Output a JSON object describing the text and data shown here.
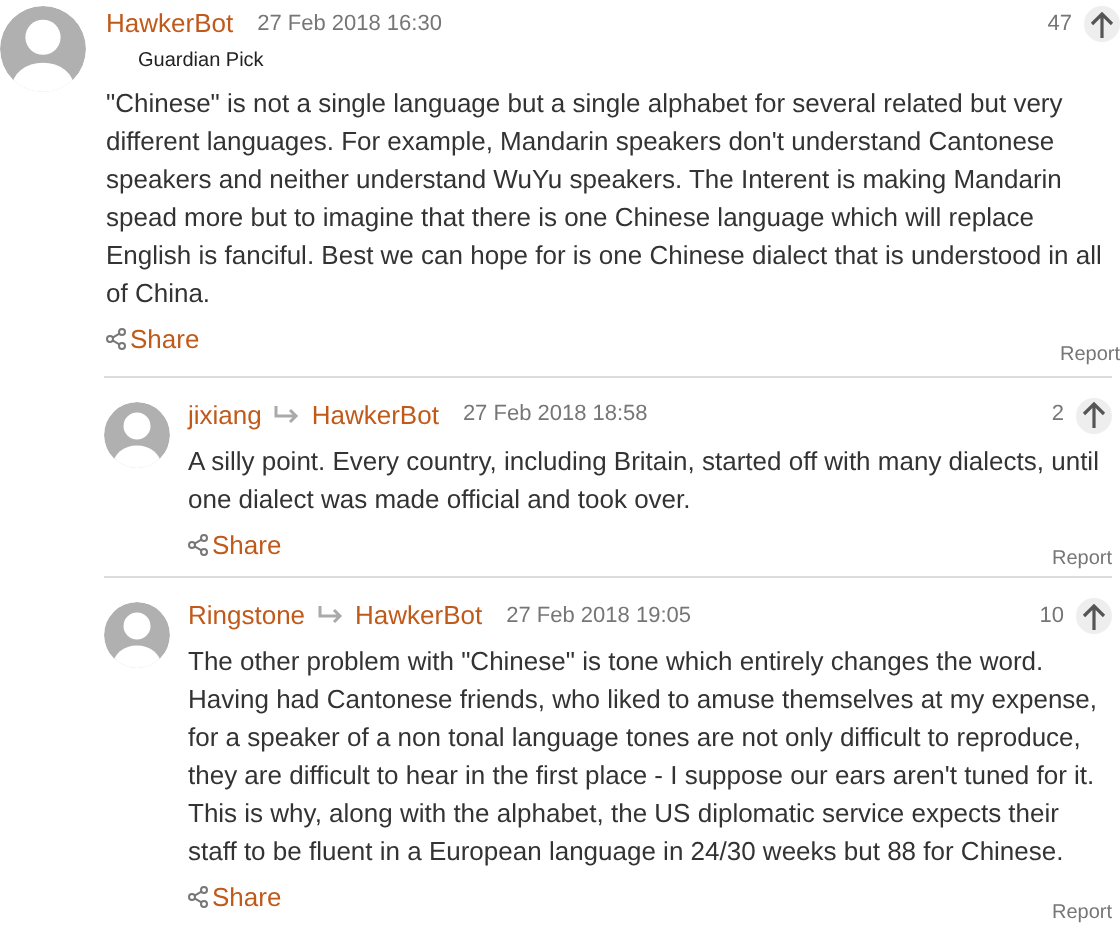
{
  "comments": [
    {
      "author": "HawkerBot",
      "timestamp": "27 Feb 2018 16:30",
      "badge": "Guardian Pick",
      "recommends": "47",
      "body": "\"Chinese\" is not a single language but a single alphabet for several related but very different languages. For example, Mandarin speakers don't understand Cantonese speakers and neither understand WuYu speakers. The Interent is making Mandarin spead more but to imagine that there is one Chinese language which will replace English is fanciful. Best we can hope for is one Chinese dialect that is understood in all of China.",
      "share": "Share",
      "report": "Report",
      "replies": [
        {
          "author": "jixiang",
          "reply_to": "HawkerBot",
          "timestamp": "27 Feb 2018 18:58",
          "recommends": "2",
          "body": "A silly point. Every country, including Britain, started off with many dialects, until one dialect was made official and took over.",
          "share": "Share",
          "report": "Report"
        },
        {
          "author": "Ringstone",
          "reply_to": "HawkerBot",
          "timestamp": "27 Feb 2018 19:05",
          "recommends": "10",
          "body": "The other problem with \"Chinese\" is tone which entirely changes the word. Having had Cantonese friends, who liked to amuse themselves at my expense, for a speaker of a non tonal language tones are not only difficult to reproduce, they are difficult to hear in the first place - I suppose our ears aren't tuned for it. This is why, along with the alphabet, the US diplomatic service expects their staff to be fluent in a European language in 24/30 weeks but 88 for Chinese.",
          "share": "Share",
          "report": "Report"
        }
      ]
    }
  ]
}
